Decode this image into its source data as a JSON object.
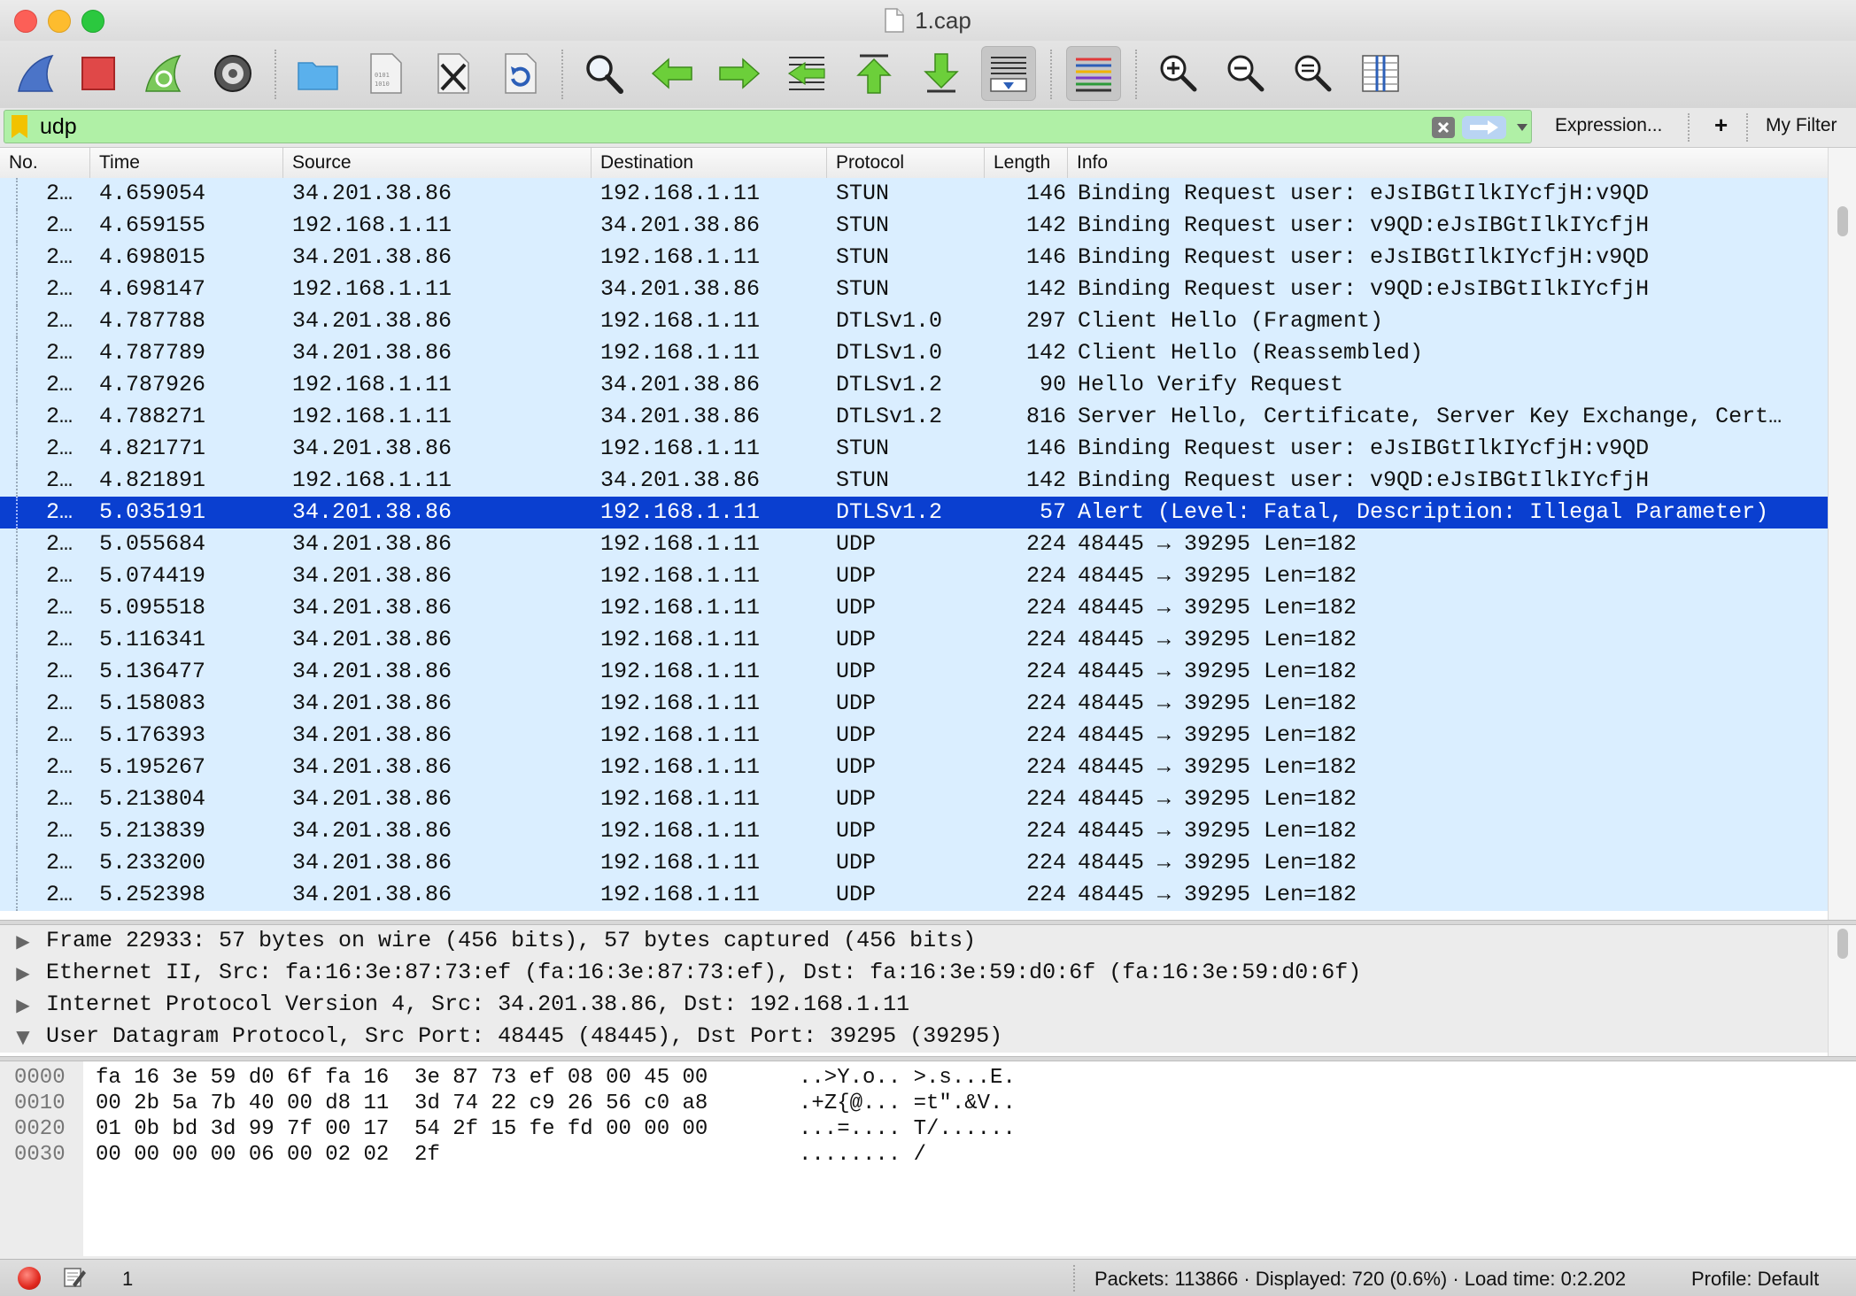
{
  "window": {
    "title": "1.cap"
  },
  "filter": {
    "value": "udp",
    "expression_label": "Expression...",
    "add_label": "+",
    "my_filter_label": "My Filter"
  },
  "columns": {
    "no": "No.",
    "time": "Time",
    "source": "Source",
    "destination": "Destination",
    "protocol": "Protocol",
    "length": "Length",
    "info": "Info"
  },
  "packets": [
    {
      "no": "2…",
      "time": "4.659054",
      "src": "34.201.38.86",
      "dst": "192.168.1.11",
      "proto": "STUN",
      "len": "146",
      "info": "Binding Request user: eJsIBGtIlkIYcfjH:v9QD"
    },
    {
      "no": "2…",
      "time": "4.659155",
      "src": "192.168.1.11",
      "dst": "34.201.38.86",
      "proto": "STUN",
      "len": "142",
      "info": "Binding Request user: v9QD:eJsIBGtIlkIYcfjH"
    },
    {
      "no": "2…",
      "time": "4.698015",
      "src": "34.201.38.86",
      "dst": "192.168.1.11",
      "proto": "STUN",
      "len": "146",
      "info": "Binding Request user: eJsIBGtIlkIYcfjH:v9QD"
    },
    {
      "no": "2…",
      "time": "4.698147",
      "src": "192.168.1.11",
      "dst": "34.201.38.86",
      "proto": "STUN",
      "len": "142",
      "info": "Binding Request user: v9QD:eJsIBGtIlkIYcfjH"
    },
    {
      "no": "2…",
      "time": "4.787788",
      "src": "34.201.38.86",
      "dst": "192.168.1.11",
      "proto": "DTLSv1.0",
      "len": "297",
      "info": "Client Hello (Fragment)"
    },
    {
      "no": "2…",
      "time": "4.787789",
      "src": "34.201.38.86",
      "dst": "192.168.1.11",
      "proto": "DTLSv1.0",
      "len": "142",
      "info": "Client Hello (Reassembled)"
    },
    {
      "no": "2…",
      "time": "4.787926",
      "src": "192.168.1.11",
      "dst": "34.201.38.86",
      "proto": "DTLSv1.2",
      "len": "90",
      "info": "Hello Verify Request"
    },
    {
      "no": "2…",
      "time": "4.788271",
      "src": "192.168.1.11",
      "dst": "34.201.38.86",
      "proto": "DTLSv1.2",
      "len": "816",
      "info": "Server Hello, Certificate, Server Key Exchange, Cert…"
    },
    {
      "no": "2…",
      "time": "4.821771",
      "src": "34.201.38.86",
      "dst": "192.168.1.11",
      "proto": "STUN",
      "len": "146",
      "info": "Binding Request user: eJsIBGtIlkIYcfjH:v9QD"
    },
    {
      "no": "2…",
      "time": "4.821891",
      "src": "192.168.1.11",
      "dst": "34.201.38.86",
      "proto": "STUN",
      "len": "142",
      "info": "Binding Request user: v9QD:eJsIBGtIlkIYcfjH"
    },
    {
      "no": "2…",
      "time": "5.035191",
      "src": "34.201.38.86",
      "dst": "192.168.1.11",
      "proto": "DTLSv1.2",
      "len": "57",
      "info": "Alert (Level: Fatal, Description: Illegal Parameter)",
      "selected": true
    },
    {
      "no": "2…",
      "time": "5.055684",
      "src": "34.201.38.86",
      "dst": "192.168.1.11",
      "proto": "UDP",
      "len": "224",
      "info": "48445 → 39295  Len=182"
    },
    {
      "no": "2…",
      "time": "5.074419",
      "src": "34.201.38.86",
      "dst": "192.168.1.11",
      "proto": "UDP",
      "len": "224",
      "info": "48445 → 39295  Len=182"
    },
    {
      "no": "2…",
      "time": "5.095518",
      "src": "34.201.38.86",
      "dst": "192.168.1.11",
      "proto": "UDP",
      "len": "224",
      "info": "48445 → 39295  Len=182"
    },
    {
      "no": "2…",
      "time": "5.116341",
      "src": "34.201.38.86",
      "dst": "192.168.1.11",
      "proto": "UDP",
      "len": "224",
      "info": "48445 → 39295  Len=182"
    },
    {
      "no": "2…",
      "time": "5.136477",
      "src": "34.201.38.86",
      "dst": "192.168.1.11",
      "proto": "UDP",
      "len": "224",
      "info": "48445 → 39295  Len=182"
    },
    {
      "no": "2…",
      "time": "5.158083",
      "src": "34.201.38.86",
      "dst": "192.168.1.11",
      "proto": "UDP",
      "len": "224",
      "info": "48445 → 39295  Len=182"
    },
    {
      "no": "2…",
      "time": "5.176393",
      "src": "34.201.38.86",
      "dst": "192.168.1.11",
      "proto": "UDP",
      "len": "224",
      "info": "48445 → 39295  Len=182"
    },
    {
      "no": "2…",
      "time": "5.195267",
      "src": "34.201.38.86",
      "dst": "192.168.1.11",
      "proto": "UDP",
      "len": "224",
      "info": "48445 → 39295  Len=182"
    },
    {
      "no": "2…",
      "time": "5.213804",
      "src": "34.201.38.86",
      "dst": "192.168.1.11",
      "proto": "UDP",
      "len": "224",
      "info": "48445 → 39295  Len=182"
    },
    {
      "no": "2…",
      "time": "5.213839",
      "src": "34.201.38.86",
      "dst": "192.168.1.11",
      "proto": "UDP",
      "len": "224",
      "info": "48445 → 39295  Len=182"
    },
    {
      "no": "2…",
      "time": "5.233200",
      "src": "34.201.38.86",
      "dst": "192.168.1.11",
      "proto": "UDP",
      "len": "224",
      "info": "48445 → 39295  Len=182"
    },
    {
      "no": "2…",
      "time": "5.252398",
      "src": "34.201.38.86",
      "dst": "192.168.1.11",
      "proto": "UDP",
      "len": "224",
      "info": "48445 → 39295  Len=182"
    }
  ],
  "details": [
    {
      "expanded": false,
      "text": "Frame 22933: 57 bytes on wire (456 bits), 57 bytes captured (456 bits)"
    },
    {
      "expanded": false,
      "text": "Ethernet II, Src: fa:16:3e:87:73:ef (fa:16:3e:87:73:ef), Dst: fa:16:3e:59:d0:6f (fa:16:3e:59:d0:6f)"
    },
    {
      "expanded": false,
      "text": "Internet Protocol Version 4, Src: 34.201.38.86, Dst: 192.168.1.11"
    },
    {
      "expanded": true,
      "text": "User Datagram Protocol, Src Port: 48445 (48445), Dst Port: 39295 (39295)"
    }
  ],
  "bytes": [
    {
      "offset": "0000",
      "hex": "fa 16 3e 59 d0 6f fa 16  3e 87 73 ef 08 00 45 00",
      "ascii": "..>Y.o.. >.s...E."
    },
    {
      "offset": "0010",
      "hex": "00 2b 5a 7b 40 00 d8 11  3d 74 22 c9 26 56 c0 a8",
      "ascii": ".+Z{@... =t\".&V.."
    },
    {
      "offset": "0020",
      "hex": "01 0b bd 3d 99 7f 00 17  54 2f 15 fe fd 00 00 00",
      "ascii": "...=.... T/......"
    },
    {
      "offset": "0030",
      "hex": "00 00 00 00 06 00 02 02  2f",
      "ascii": "........ /"
    }
  ],
  "status": {
    "count": "1",
    "packets": "Packets: 113866 · Displayed: 720 (0.6%) · Load time: 0:2.202",
    "profile": "Profile: Default"
  },
  "colors": {
    "row_bg": "#daeeff",
    "selected_bg": "#0a3fd0",
    "filter_ok": "#b0f0a6"
  },
  "icons": {
    "toolbar": [
      "shark-fin-start-icon",
      "stop-capture-icon",
      "restart-capture-icon",
      "capture-options-icon",
      "open-file-icon",
      "save-file-icon",
      "close-file-icon",
      "reload-file-icon",
      "find-packet-icon",
      "go-back-icon",
      "go-forward-icon",
      "go-to-packet-icon",
      "first-packet-icon",
      "last-packet-icon",
      "auto-scroll-icon",
      "colorize-icon",
      "zoom-in-icon",
      "zoom-out-icon",
      "normal-size-icon",
      "resize-columns-icon"
    ]
  }
}
